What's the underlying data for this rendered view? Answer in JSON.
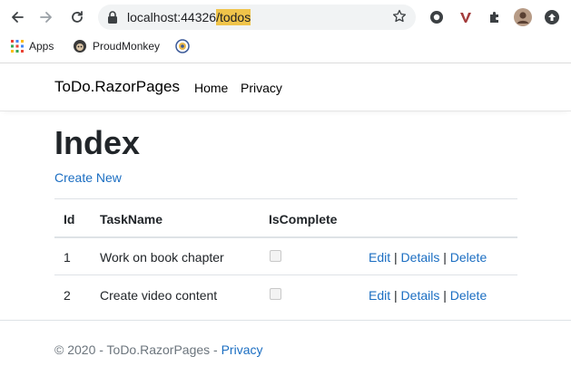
{
  "browser": {
    "url_prefix": "localhost:44326",
    "url_highlight": "/todos",
    "bookmarks": [
      {
        "label": "Apps",
        "icon": "apps-grid-icon"
      },
      {
        "label": "ProudMonkey",
        "icon": "monkey-icon"
      },
      {
        "label": "",
        "icon": "globe-badge-icon"
      }
    ]
  },
  "nav": {
    "brand": "ToDo.RazorPages",
    "links": [
      "Home",
      "Privacy"
    ]
  },
  "main": {
    "title": "Index",
    "create_link": "Create New",
    "columns": [
      "Id",
      "TaskName",
      "IsComplete"
    ],
    "rows": [
      {
        "id": "1",
        "task": "Work on book chapter",
        "complete": false
      },
      {
        "id": "2",
        "task": "Create video content",
        "complete": false
      }
    ],
    "actions": {
      "edit": "Edit",
      "details": "Details",
      "delete": "Delete",
      "sep": "|"
    }
  },
  "footer": {
    "prefix": "© 2020 - ToDo.RazorPages - ",
    "link": "Privacy"
  },
  "colors": {
    "link": "#1b6ec2",
    "url_highlight": "#f0c44a"
  }
}
